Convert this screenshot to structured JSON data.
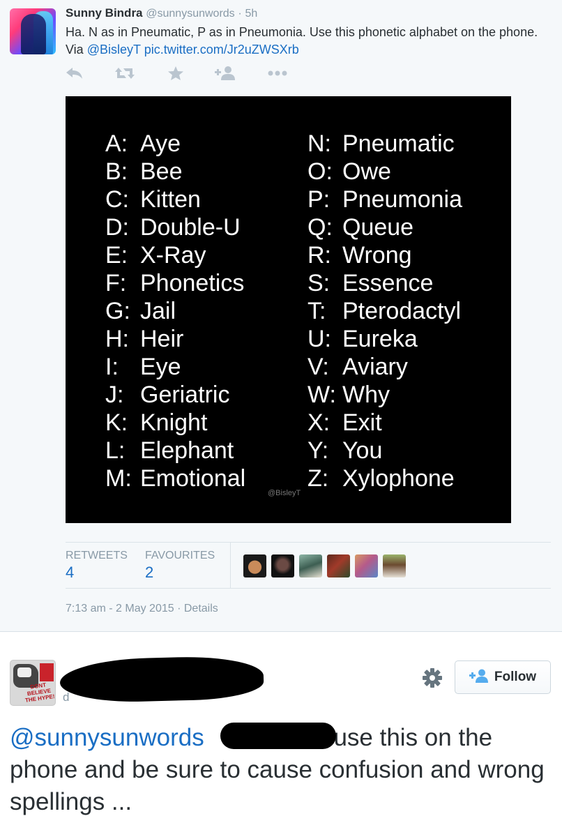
{
  "tweet": {
    "author_name": "Sunny Bindra",
    "author_handle": "@sunnysunwords",
    "separator": "·",
    "time_ago": "5h",
    "text_before_link": "Ha. N as in Pneumatic, P as in Pneumonia. Use this phonetic alphabet on the phone. Via",
    "mention": "@BisleyT",
    "media_link": "pic.twitter.com/Jr2uZWSXrb",
    "image": {
      "left_column": [
        {
          "letter": "A:",
          "word": "Aye"
        },
        {
          "letter": "B:",
          "word": "Bee"
        },
        {
          "letter": "C:",
          "word": "Kitten"
        },
        {
          "letter": "D:",
          "word": "Double-U"
        },
        {
          "letter": "E:",
          "word": "X-Ray"
        },
        {
          "letter": "F:",
          "word": "Phonetics"
        },
        {
          "letter": "G:",
          "word": "Jail"
        },
        {
          "letter": "H:",
          "word": "Heir"
        },
        {
          "letter": "I:",
          "word": "Eye"
        },
        {
          "letter": "J:",
          "word": "Geriatric"
        },
        {
          "letter": "K:",
          "word": "Knight"
        },
        {
          "letter": "L:",
          "word": "Elephant"
        },
        {
          "letter": "M:",
          "word": "Emotional"
        }
      ],
      "right_column": [
        {
          "letter": "N:",
          "word": "Pneumatic"
        },
        {
          "letter": "O:",
          "word": "Owe"
        },
        {
          "letter": "P:",
          "word": "Pneumonia"
        },
        {
          "letter": "Q:",
          "word": "Queue"
        },
        {
          "letter": "R:",
          "word": "Wrong"
        },
        {
          "letter": "S:",
          "word": "Essence"
        },
        {
          "letter": "T:",
          "word": "Pterodactyl"
        },
        {
          "letter": "U:",
          "word": "Eureka"
        },
        {
          "letter": "V:",
          "word": "Aviary"
        },
        {
          "letter": "W:",
          "word": "Why"
        },
        {
          "letter": "X:",
          "word": "Exit"
        },
        {
          "letter": "Y:",
          "word": "You"
        },
        {
          "letter": "Z:",
          "word": "Xylophone"
        }
      ],
      "watermark": "@BisleyT"
    },
    "stats": {
      "retweets_label": "RETWEETS",
      "retweets_count": "4",
      "favourites_label": "FAVOURITES",
      "favourites_count": "2"
    },
    "timestamp": "7:13 am - 2 May 2015",
    "details_label": "Details",
    "icons": [
      "reply-icon",
      "retweet-icon",
      "favorite-star-icon",
      "follow-user-icon",
      "more-dots-icon"
    ]
  },
  "reply": {
    "handle_hint": "d",
    "follow_label": "Follow",
    "mention": "@sunnysunwords",
    "text_part1": "use this on the",
    "text_part2": "phone and be sure to cause confusion and wrong spellings ...",
    "avatar_text": "DONT BELIEVE THE HYPE!",
    "icons": [
      "gear-icon",
      "add-user-icon"
    ]
  },
  "colors": {
    "link": "#1a6ec4",
    "muted": "#8899a6",
    "text": "#292f33",
    "background": "#f5f8fa"
  }
}
